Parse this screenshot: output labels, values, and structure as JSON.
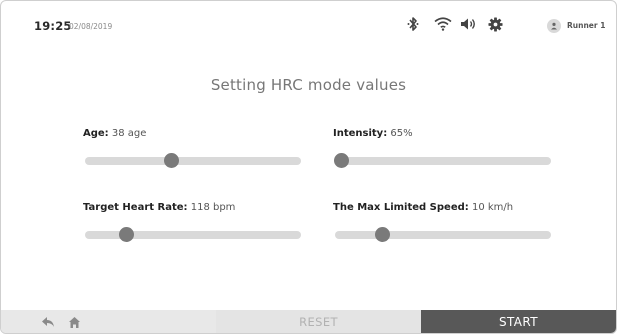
{
  "status_bar": {
    "time": "19:25",
    "date": "02/08/2019",
    "icons": [
      "bluetooth-icon",
      "wifi-icon",
      "volume-icon",
      "settings-gear-icon",
      "user-avatar-icon"
    ],
    "user_name": "Runner 1"
  },
  "title": "Setting HRC mode values",
  "settings": {
    "age": {
      "label": "Age:",
      "value": "38 age",
      "level": 0.4
    },
    "intensity": {
      "label": "Intensity:",
      "value": "65%",
      "level": 0.03
    },
    "target_heart_rate": {
      "label": "Target Heart Rate:",
      "value": "118 bpm",
      "level": 0.19
    },
    "max_speed": {
      "label": "The Max Limited Speed:",
      "value": "10 km/h",
      "level": 0.22
    }
  },
  "bottom_bar": {
    "icons": [
      "back-arrow-icon",
      "home-icon"
    ],
    "reset_label": "RESET",
    "start_label": "START"
  },
  "colors": {
    "slider_track": "#d9d9d9",
    "slider_thumb": "#7a7a7a",
    "reset_bg": "#e4e4e4",
    "start_bg": "#585858"
  }
}
